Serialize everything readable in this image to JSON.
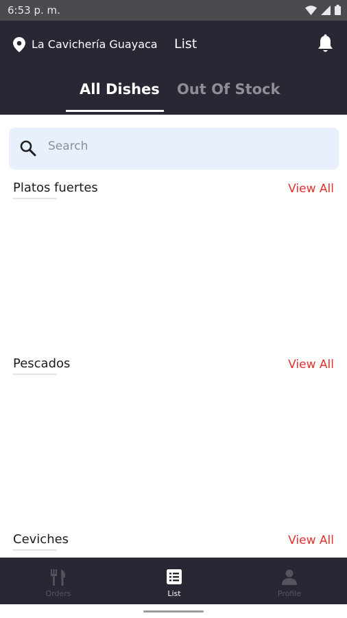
{
  "status_bar": {
    "time": "6:53 p. m."
  },
  "header": {
    "location_name": "La Cavichería Guayaca",
    "title": "List",
    "tabs": [
      {
        "label": "All Dishes",
        "active": true
      },
      {
        "label": "Out Of Stock",
        "active": false
      }
    ]
  },
  "search": {
    "placeholder": "Search"
  },
  "sections": [
    {
      "title": "Platos fuertes",
      "action": "View All"
    },
    {
      "title": "Pescados",
      "action": "View All"
    },
    {
      "title": "Ceviches",
      "action": "View All"
    }
  ],
  "bottom_nav": [
    {
      "label": "Orders",
      "icon": "fork-knife-icon",
      "active": false
    },
    {
      "label": "List",
      "icon": "list-icon",
      "active": true
    },
    {
      "label": "Profile",
      "icon": "person-icon",
      "active": false
    }
  ],
  "colors": {
    "header_bg": "#292733",
    "accent_red": "#e0312e",
    "search_bg": "#e8f0fd"
  }
}
